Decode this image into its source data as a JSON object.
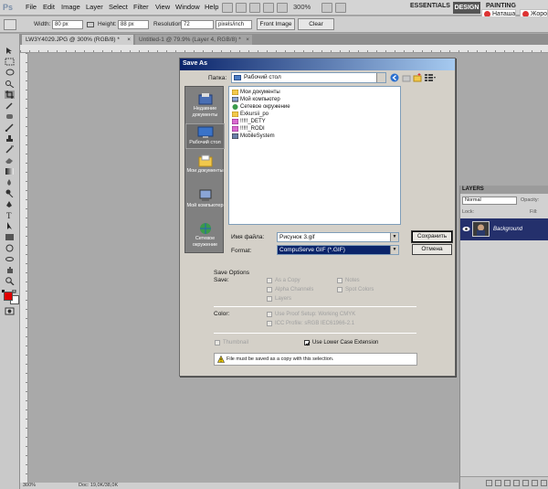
{
  "app": {
    "logo": "Ps",
    "menu": [
      "File",
      "Edit",
      "Image",
      "Layer",
      "Select",
      "Filter",
      "View",
      "Window",
      "Help"
    ],
    "zoom": "300%",
    "workspaces": {
      "essentials": "ESSENTIALS",
      "design": "DESIGN",
      "painting": "PAINTING"
    },
    "users": [
      "Наташа",
      "Жоро"
    ]
  },
  "options_bar": {
    "width_label": "Width:",
    "width_value": "80 px",
    "height_label": "Height:",
    "height_value": "88 px",
    "resolution_label": "Resolution:",
    "resolution_value": "72",
    "resolution_unit": "pixels/inch",
    "front_image": "Front Image",
    "clear": "Clear"
  },
  "documents": [
    {
      "title": "LW3Y4029.JPG @ 300% (RGB/8) *"
    },
    {
      "title": "Untitled-1 @ 79.9% (Layer 4, RGB/8) *"
    }
  ],
  "status": {
    "zoom": "300%",
    "doc": "Doc: 19,0K/38,0K"
  },
  "layers_panel": {
    "tab": "LAYERS",
    "blend_mode": "Normal",
    "opacity_label": "Opacity:",
    "lock_label": "Lock:",
    "fill_label": "Fill:",
    "layer_name": "Background"
  },
  "dialog": {
    "title": "Save As",
    "folder_label": "Папка:",
    "folder_value": "Рабочий стол",
    "places": [
      {
        "label": "Недавние документы"
      },
      {
        "label": "Рабочий стол"
      },
      {
        "label": "Мои документы"
      },
      {
        "label": "Мой компьютер"
      },
      {
        "label": "Сетевое окружение"
      }
    ],
    "files": [
      "Мои документы",
      "Мой компьютер",
      "Сетевое окружение",
      "Exkursii_po",
      "!!!!!_DETY",
      "!!!!!_RODI",
      "MobileSystem"
    ],
    "filename_label": "Имя файла:",
    "filename_value": "Рисунок 3.gif",
    "format_label": "Format:",
    "format_value": "CompuServe GIF (*.GIF)",
    "save_button": "Сохранить",
    "cancel_button": "Отмена",
    "save_options_title": "Save Options",
    "save_label": "Save:",
    "opt_as_copy": "As a Copy",
    "opt_alpha": "Alpha Channels",
    "opt_layers": "Layers",
    "opt_notes": "Notes",
    "opt_spot": "Spot Colors",
    "color_label": "Color:",
    "opt_proof": "Use Proof Setup:  Working CMYK",
    "opt_icc": "ICC Profile:  sRGB IEC61966-2.1",
    "opt_thumbnail": "Thumbnail",
    "opt_lowercase": "Use Lower Case Extension",
    "warning": "File must be saved as a copy with this selection."
  }
}
